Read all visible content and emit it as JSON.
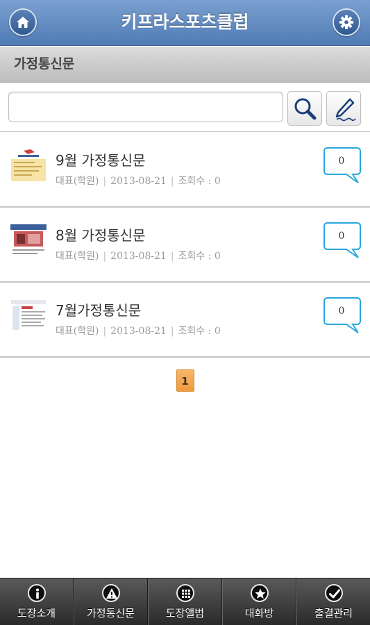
{
  "header": {
    "title": "키프라스포츠클럽"
  },
  "section": {
    "title": "가정통신문"
  },
  "search": {
    "value": "",
    "placeholder": ""
  },
  "posts": [
    {
      "title": "9월 가정통신문",
      "author": "대표(학원)",
      "date": "2013-08-21",
      "views": "조회수 : 0",
      "comments": "0"
    },
    {
      "title": "8월 가정통신문",
      "author": "대표(학원)",
      "date": "2013-08-21",
      "views": "조회수 : 0",
      "comments": "0"
    },
    {
      "title": "7월가정통신문",
      "author": "대표(학원)",
      "date": "2013-08-21",
      "views": "조회수 : 0",
      "comments": "0"
    }
  ],
  "pagination": {
    "current": "1"
  },
  "tabs": [
    {
      "label": "도장소개",
      "icon": "info-icon"
    },
    {
      "label": "가정통신문",
      "icon": "warning-icon"
    },
    {
      "label": "도장앨범",
      "icon": "grid-icon"
    },
    {
      "label": "대화방",
      "icon": "star-icon"
    },
    {
      "label": "출결관리",
      "icon": "check-icon"
    }
  ],
  "colors": {
    "header": "#5a84bb",
    "accent_blue": "#29a8e0",
    "page_active": "#f4a64f",
    "tabbar": "#3a3a3a"
  }
}
